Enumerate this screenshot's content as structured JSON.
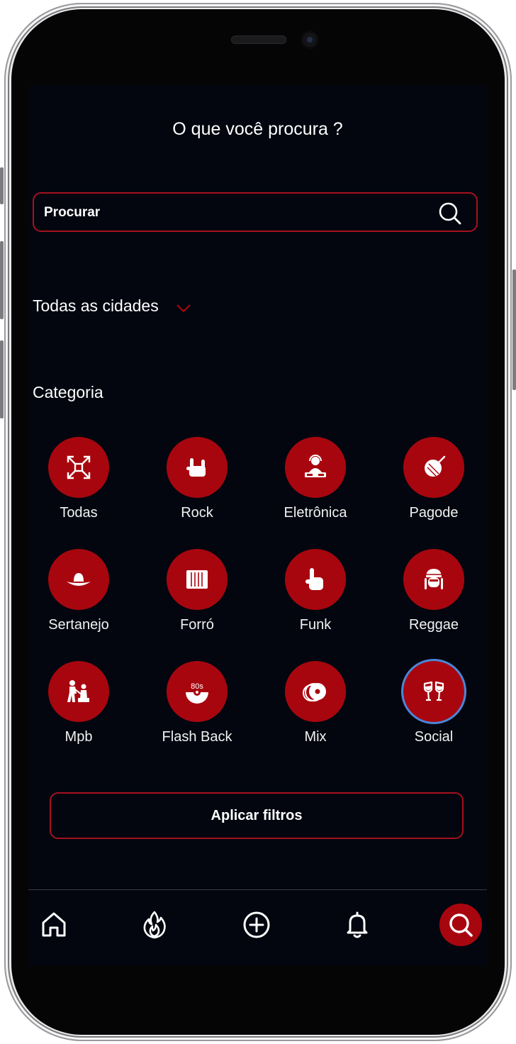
{
  "header": {
    "title": "O que você procura ?"
  },
  "search": {
    "placeholder": "Procurar",
    "icon": "search-icon"
  },
  "city_filter": {
    "selected": "Todas as cidades",
    "icon": "chevron-down-icon"
  },
  "category_section": {
    "heading": "Categoria"
  },
  "categories": [
    {
      "label": "Todas",
      "icon": "expand-arrows-icon",
      "selected": false
    },
    {
      "label": "Rock",
      "icon": "rock-hand-icon",
      "selected": false
    },
    {
      "label": "Eletrônica",
      "icon": "dj-icon",
      "selected": false
    },
    {
      "label": "Pagode",
      "icon": "drum-icon",
      "selected": false
    },
    {
      "label": "Sertanejo",
      "icon": "cowboy-hat-icon",
      "selected": false
    },
    {
      "label": "Forró",
      "icon": "accordion-icon",
      "selected": false
    },
    {
      "label": "Funk",
      "icon": "pointing-hand-icon",
      "selected": false
    },
    {
      "label": "Reggae",
      "icon": "rasta-icon",
      "selected": false
    },
    {
      "label": "Mpb",
      "icon": "singer-guitar-icon",
      "selected": false
    },
    {
      "label": "Flash Back",
      "icon": "vinyl-80s-icon",
      "selected": false
    },
    {
      "label": "Mix",
      "icon": "cd-stack-icon",
      "selected": false
    },
    {
      "label": "Social",
      "icon": "toast-glasses-icon",
      "selected": true
    }
  ],
  "apply_button": {
    "label": "Aplicar filtros"
  },
  "bottom_nav": [
    {
      "name": "home",
      "icon": "home-icon",
      "active": false
    },
    {
      "name": "trending",
      "icon": "flame-icon",
      "active": false
    },
    {
      "name": "add",
      "icon": "plus-circle-icon",
      "active": false
    },
    {
      "name": "notifications",
      "icon": "bell-icon",
      "active": false
    },
    {
      "name": "search",
      "icon": "search-icon",
      "active": true
    }
  ],
  "colors": {
    "accent": "#a8060f",
    "background": "#03060f",
    "selected_ring": "#4b86d6"
  }
}
